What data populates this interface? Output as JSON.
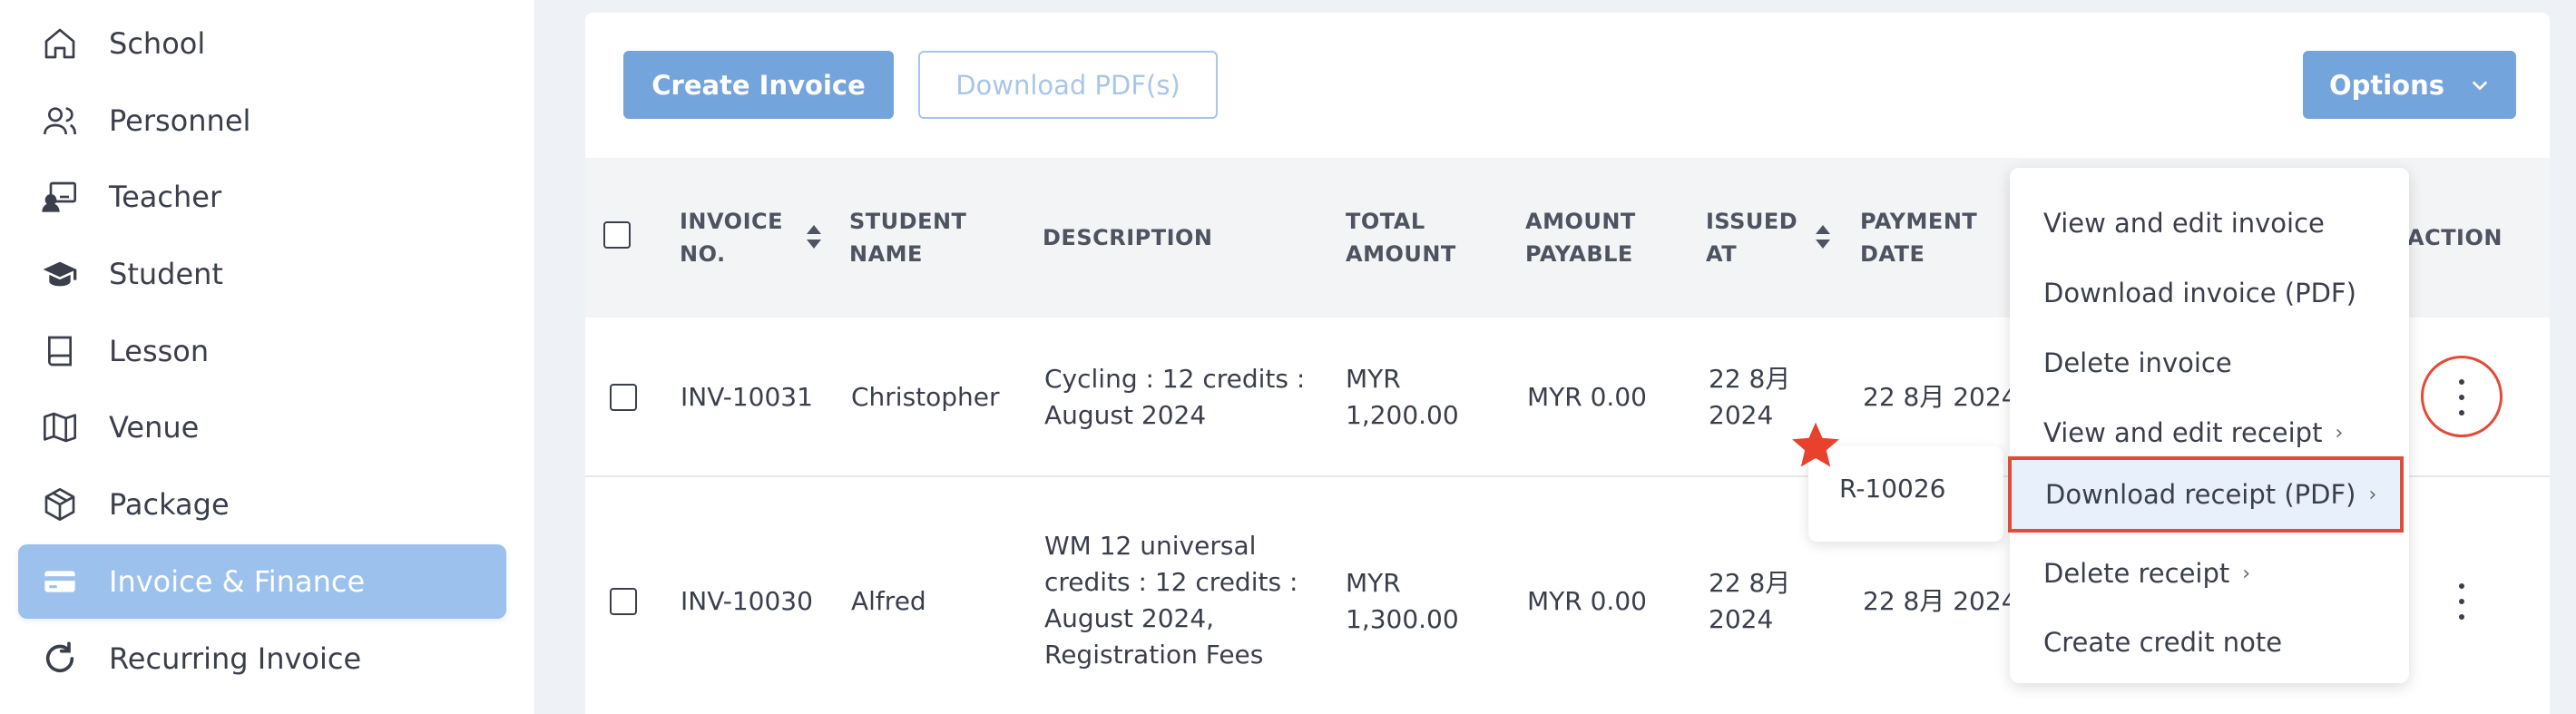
{
  "sidebar": {
    "items": [
      {
        "label": "School",
        "icon": "home-icon",
        "active": false
      },
      {
        "label": "Personnel",
        "icon": "users-icon",
        "active": false
      },
      {
        "label": "Teacher",
        "icon": "teacher-icon",
        "active": false
      },
      {
        "label": "Student",
        "icon": "graduation-cap-icon",
        "active": false
      },
      {
        "label": "Lesson",
        "icon": "book-icon",
        "active": false
      },
      {
        "label": "Venue",
        "icon": "map-icon",
        "active": false
      },
      {
        "label": "Package",
        "icon": "package-icon",
        "active": false
      },
      {
        "label": "Invoice & Finance",
        "icon": "credit-card-icon",
        "active": true
      },
      {
        "label": "Recurring Invoice",
        "icon": "refresh-icon",
        "active": false
      }
    ]
  },
  "toolbar": {
    "create_label": "Create Invoice",
    "download_label": "Download PDF(s)",
    "options_label": "Options"
  },
  "table": {
    "headers": {
      "invoice_no": [
        "INVOICE",
        "NO."
      ],
      "student_name": [
        "STUDENT",
        "NAME"
      ],
      "description": [
        "DESCRIPTION"
      ],
      "total_amount": [
        "TOTAL",
        "AMOUNT"
      ],
      "amount_payable": [
        "AMOUNT",
        "PAYABLE"
      ],
      "issued_at": [
        "ISSUED",
        "AT"
      ],
      "payment_date": [
        "PAYMENT",
        "DATE"
      ],
      "action": [
        "ACTION"
      ]
    },
    "rows": [
      {
        "invoice_no": "INV-10031",
        "student_name": "Christopher",
        "description": [
          "Cycling : 12 credits :",
          "August 2024"
        ],
        "total_amount": [
          "MYR",
          "1,200.00"
        ],
        "amount_payable": "MYR 0.00",
        "issued_at": [
          "22 8月",
          "2024"
        ],
        "payment_date": "22 8月 2024"
      },
      {
        "invoice_no": "INV-10030",
        "student_name": "Alfred",
        "description": [
          "WM 12 universal",
          "credits : 12 credits :",
          "August 2024,",
          "Registration Fees"
        ],
        "total_amount": [
          "MYR",
          "1,300.00"
        ],
        "amount_payable": "MYR 0.00",
        "issued_at": [
          "22 8月",
          "2024"
        ],
        "payment_date": "22 8月 2024"
      }
    ]
  },
  "action_menu": {
    "items": [
      {
        "label": "View and edit invoice",
        "has_sub": false
      },
      {
        "label": "Download invoice (PDF)",
        "has_sub": false
      },
      {
        "label": "Delete invoice",
        "has_sub": false
      },
      {
        "label": "View and edit receipt",
        "has_sub": true
      },
      {
        "label": "Download receipt (PDF)",
        "has_sub": true
      },
      {
        "label": "Delete receipt",
        "has_sub": true
      },
      {
        "label": "Create credit note",
        "has_sub": false
      }
    ],
    "submenu_chevron": "›"
  },
  "submenu": {
    "items": [
      "R-10026"
    ]
  },
  "colors": {
    "accent": "#74a4dc",
    "active_nav": "#9cc1ec",
    "highlight_border": "#e14b37",
    "star": "#e8412c"
  }
}
